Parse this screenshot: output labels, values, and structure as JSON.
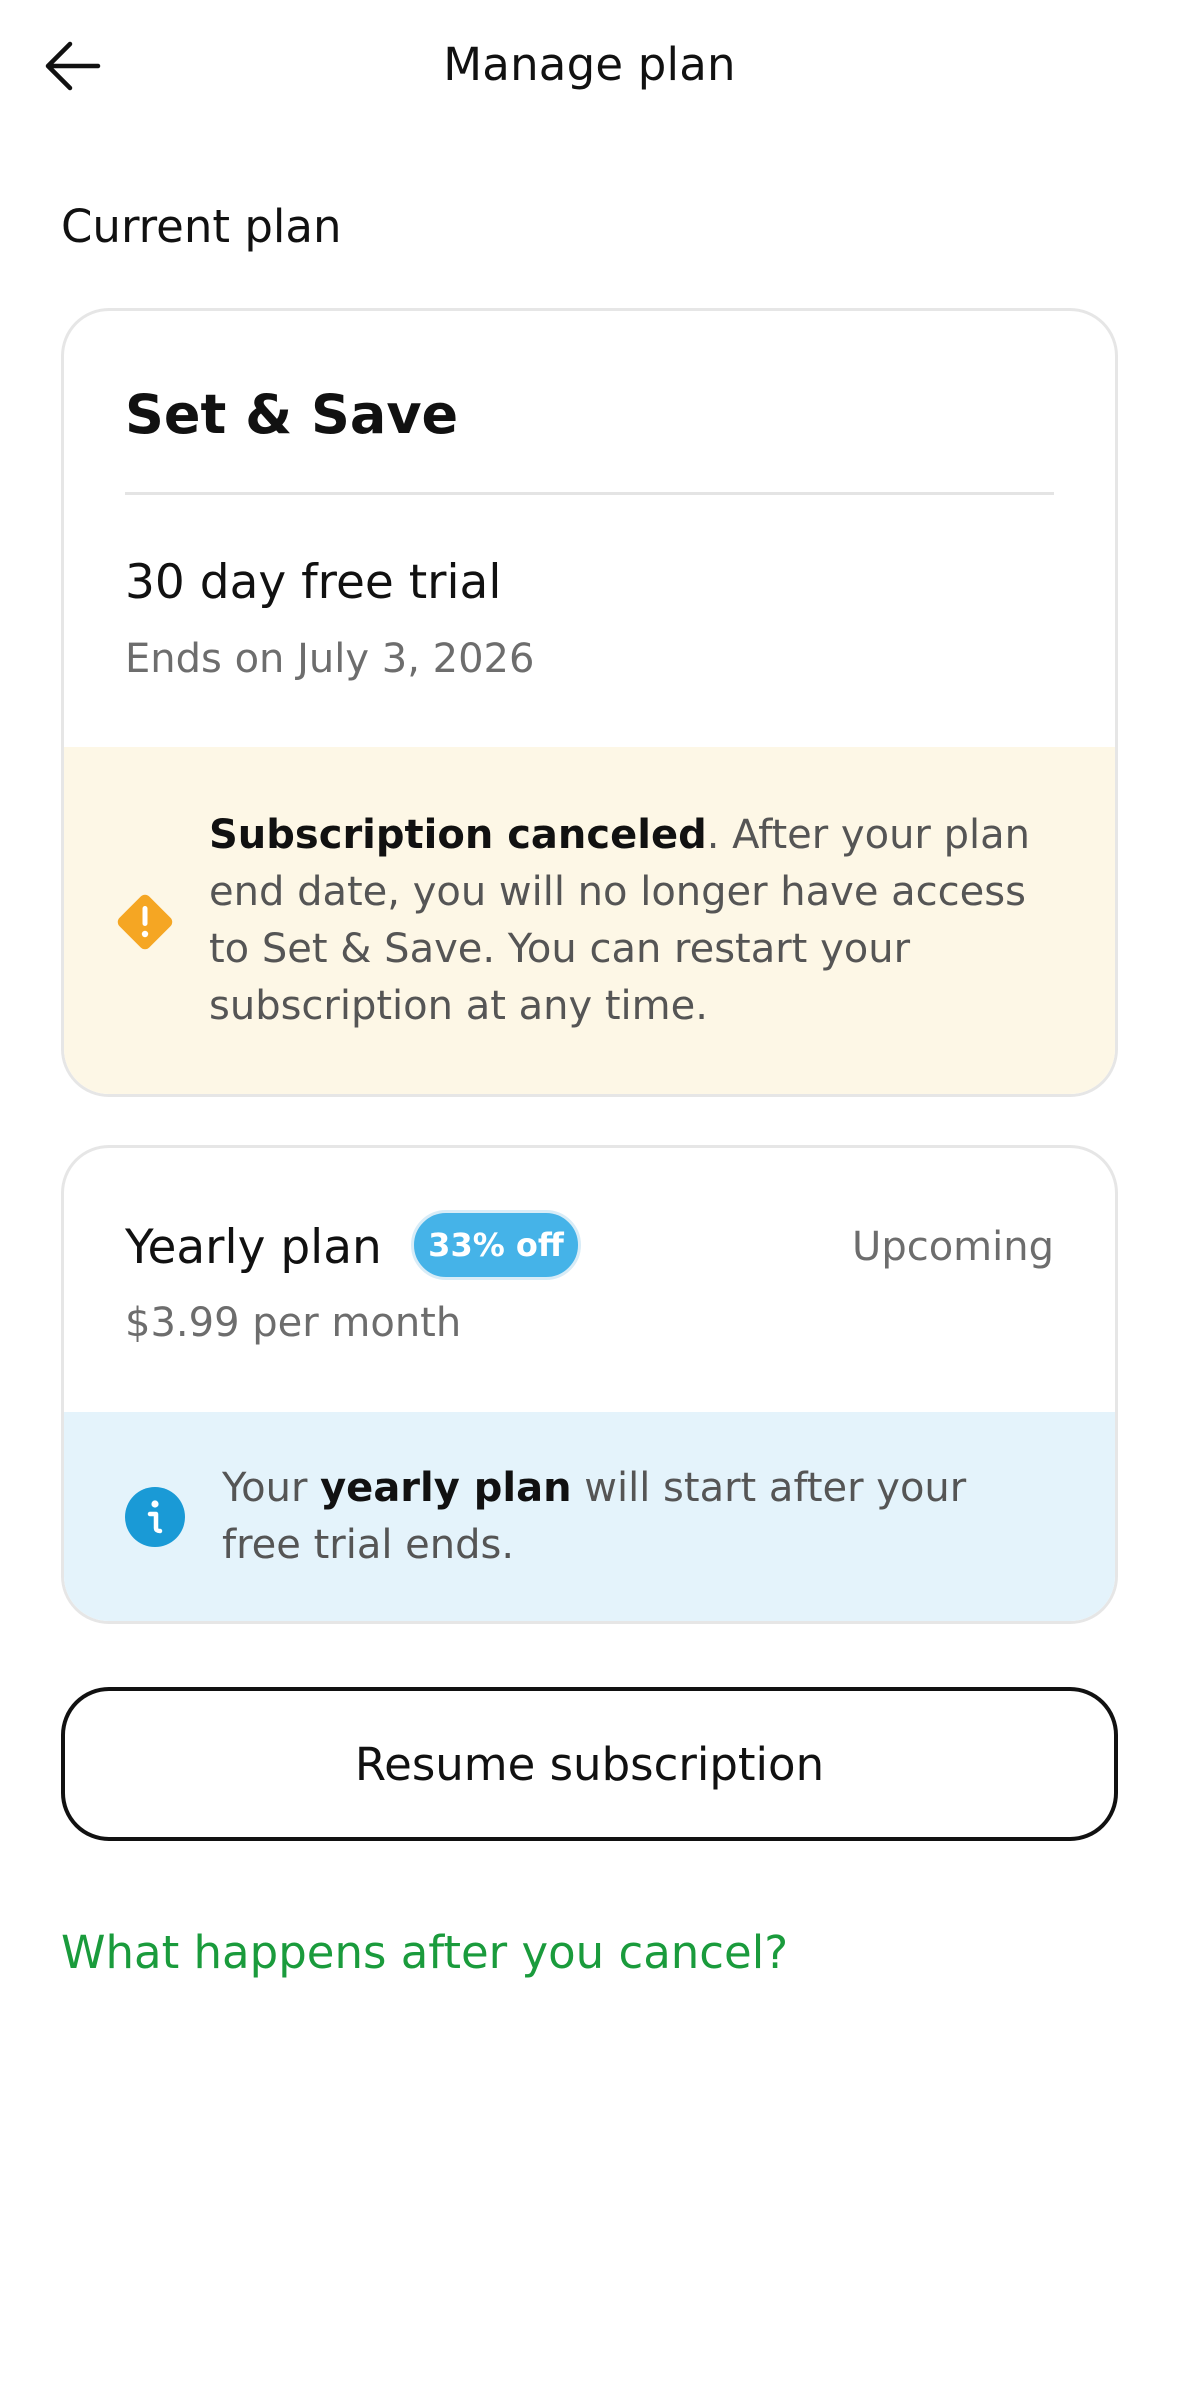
{
  "header": {
    "title": "Manage plan",
    "back_icon": "arrow-left-icon"
  },
  "current_plan": {
    "section_title": "Current plan",
    "plan_name": "Set & Save",
    "trial_title": "30 day free trial",
    "trial_end": "Ends on July 3, 2026",
    "warning": {
      "icon": "warning-diamond-icon",
      "bold": "Subscription canceled",
      "text": ". After your plan end date, you will no longer have access to Set & Save. You can restart your subscription at any time."
    }
  },
  "yearly_plan": {
    "title": "Yearly plan",
    "badge": "33% off",
    "status": "Upcoming",
    "price": "$3.99 per month",
    "info": {
      "icon": "info-icon",
      "prefix": "Your ",
      "bold": "yearly plan",
      "suffix": " will start after your free trial ends."
    }
  },
  "actions": {
    "resume_label": "Resume subscription",
    "cancel_link": "What happens after you cancel?"
  },
  "colors": {
    "warning_bg": "#fdf7e6",
    "warning_icon": "#f5a623",
    "info_bg": "#e4f3fb",
    "info_icon": "#1a9ad6",
    "badge_bg": "#45b3e8",
    "link_green": "#1a9b3c"
  }
}
